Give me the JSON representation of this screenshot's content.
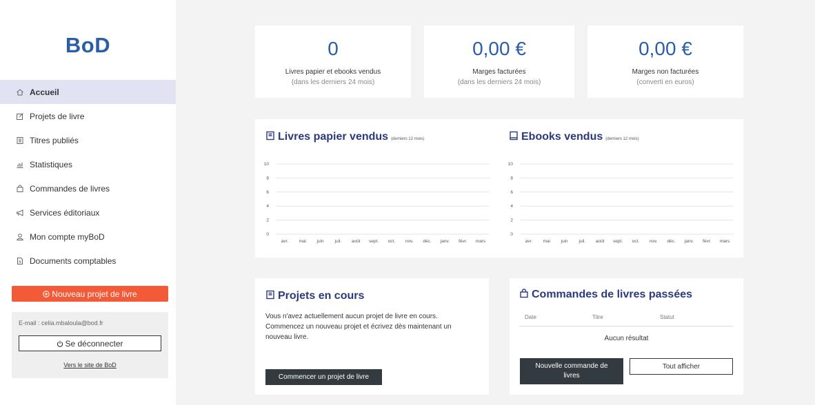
{
  "sidebar": {
    "logo": "BoD",
    "items": [
      {
        "label": "Accueil",
        "icon": "home-icon",
        "active": true
      },
      {
        "label": "Projets de livre",
        "icon": "edit-icon"
      },
      {
        "label": "Titres publiés",
        "icon": "book-icon"
      },
      {
        "label": "Statistiques",
        "icon": "bar-chart-icon"
      },
      {
        "label": "Commandes de livres",
        "icon": "shopping-bag-icon"
      },
      {
        "label": "Services éditoriaux",
        "icon": "megaphone-icon"
      },
      {
        "label": "Mon compte myBoD",
        "icon": "user-icon"
      },
      {
        "label": "Documents comptables",
        "icon": "document-icon"
      }
    ],
    "new_project": "Nouveau projet de livre",
    "email": "E-mail : celia.mbaloula@bod.fr",
    "logout": "Se déconnecter",
    "site_link": "Vers le site de BoD"
  },
  "stats": [
    {
      "value": "0",
      "label": "Livres papier et ebooks vendus",
      "sub": "(dans les derniers 24 mois)"
    },
    {
      "value": "0,00 €",
      "label": "Marges facturées",
      "sub": "(dans les derniers 24 mois)"
    },
    {
      "value": "0,00 €",
      "label": "Marges non facturées",
      "sub": "(converti en euros)"
    }
  ],
  "charts_section": {
    "paper_title": "Livres papier vendus",
    "paper_sub": "(derniers 12 mois)",
    "ebook_title": "Ebooks vendus",
    "ebook_sub": "(derniers 12 mois)"
  },
  "chart_data": [
    {
      "type": "bar",
      "title": "Livres papier vendus",
      "categories": [
        "avr.",
        "mai",
        "juin",
        "juil.",
        "août",
        "sept.",
        "oct.",
        "nov.",
        "déc.",
        "janv.",
        "févr.",
        "mars"
      ],
      "values": [
        0,
        0,
        0,
        0,
        0,
        0,
        0,
        0,
        0,
        0,
        0,
        0
      ],
      "yticks": [
        "0",
        "2",
        "4",
        "6",
        "8",
        "10"
      ],
      "ylim": [
        0,
        10
      ],
      "grid": true
    },
    {
      "type": "bar",
      "title": "Ebooks vendus",
      "categories": [
        "avr.",
        "mai",
        "juin",
        "juil.",
        "août",
        "sept.",
        "oct.",
        "nov.",
        "déc.",
        "janv.",
        "févr.",
        "mars"
      ],
      "values": [
        0,
        0,
        0,
        0,
        0,
        0,
        0,
        0,
        0,
        0,
        0,
        0
      ],
      "yticks": [
        "0",
        "2",
        "4",
        "6",
        "8",
        "10"
      ],
      "ylim": [
        0,
        10
      ],
      "grid": true
    }
  ],
  "projects": {
    "title": "Projets en cours",
    "text": "Vous n'avez actuellement aucun projet de livre en cours. Commencez un nouveau projet et écrivez dès maintenant un nouveau livre.",
    "button": "Commencer un projet de livre"
  },
  "orders": {
    "title": "Commandes de livres passées",
    "columns": [
      "Date",
      "Titre",
      "Statut"
    ],
    "empty": "Aucun résultat",
    "new_order": "Nouvelle commande de livres",
    "show_all": "Tout afficher"
  },
  "colors": {
    "accent": "#2a5ea7",
    "title": "#2a3a7c",
    "primary_button": "#f25a38",
    "dark_button": "#333a40",
    "active_nav": "#e1e3f3"
  }
}
